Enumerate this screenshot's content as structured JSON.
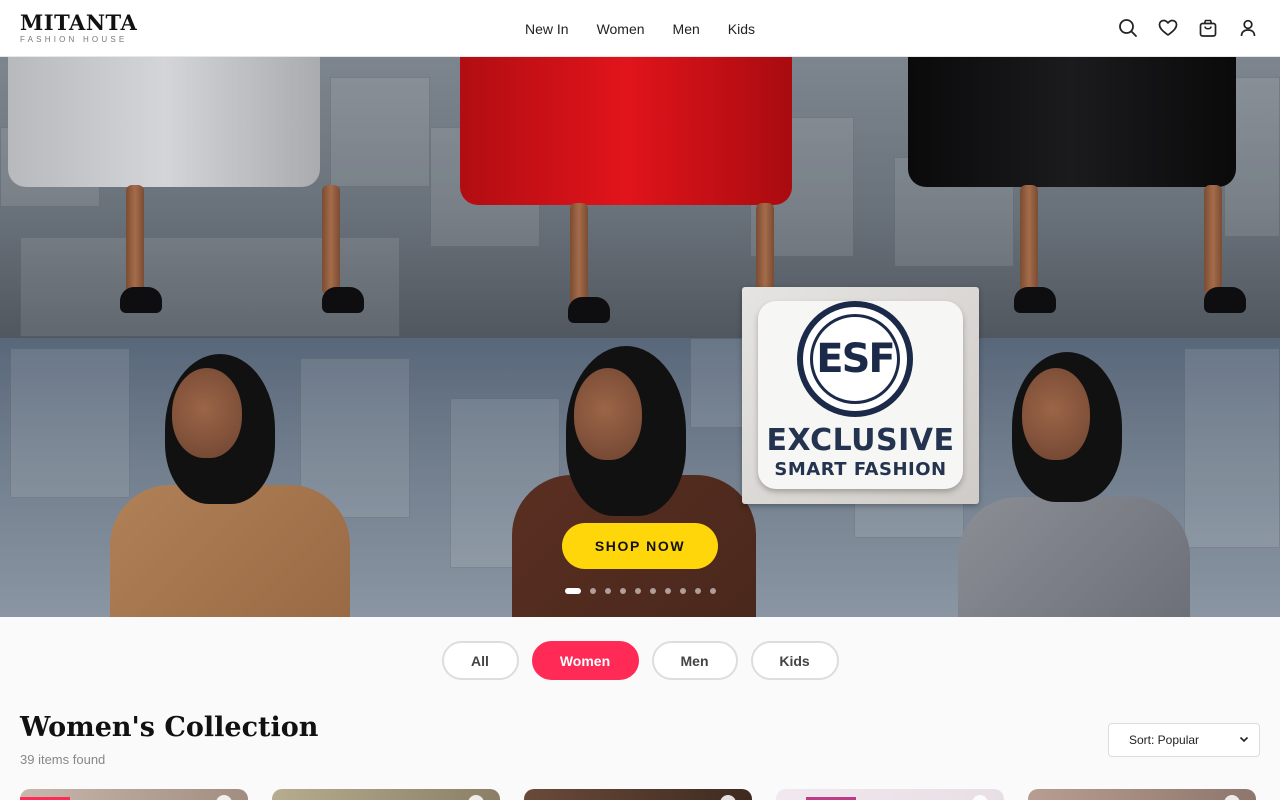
{
  "brand": {
    "name": "MITANTA",
    "tagline": "FASHION HOUSE"
  },
  "nav": [
    "New In",
    "Women",
    "Men",
    "Kids"
  ],
  "header_icons": [
    "search-icon",
    "heart-icon",
    "bag-icon",
    "user-icon"
  ],
  "hero": {
    "badge_monogram": "ESF",
    "badge_title": "EXCLUSIVE",
    "badge_subtitle": "SMART FASHION",
    "cta": "SHOP NOW",
    "slide_count": 10,
    "active_slide": 1
  },
  "filters": [
    {
      "label": "All",
      "active": false
    },
    {
      "label": "Women",
      "active": true
    },
    {
      "label": "Men",
      "active": false
    },
    {
      "label": "Kids",
      "active": false
    }
  ],
  "collection": {
    "title": "Women's Collection",
    "count": "39 items found",
    "sort_value": "Sort: Popular"
  },
  "colors": {
    "accent": "#ff2a55",
    "cta": "#ffd60a"
  }
}
